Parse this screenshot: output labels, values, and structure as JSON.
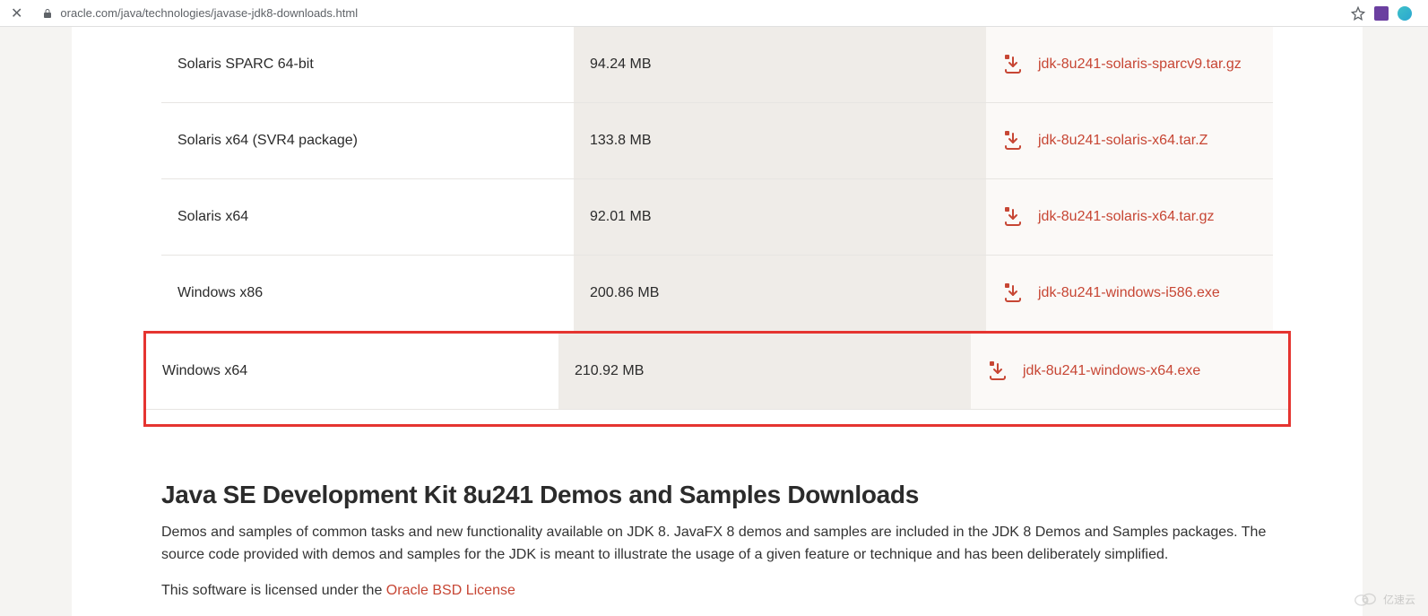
{
  "browser": {
    "url": "oracle.com/java/technologies/javase-jdk8-downloads.html"
  },
  "downloads": [
    {
      "os": "Solaris SPARC 64-bit",
      "size": "94.24 MB",
      "file": "jdk-8u241-solaris-sparcv9.tar.gz",
      "highlighted": false
    },
    {
      "os": "Solaris x64 (SVR4 package)",
      "size": "133.8 MB",
      "file": "jdk-8u241-solaris-x64.tar.Z",
      "highlighted": false
    },
    {
      "os": "Solaris x64",
      "size": "92.01 MB",
      "file": "jdk-8u241-solaris-x64.tar.gz",
      "highlighted": false
    },
    {
      "os": "Windows x86",
      "size": "200.86 MB",
      "file": "jdk-8u241-windows-i586.exe",
      "highlighted": false
    },
    {
      "os": "Windows x64",
      "size": "210.92 MB",
      "file": "jdk-8u241-windows-x64.exe",
      "highlighted": true
    }
  ],
  "section": {
    "heading": "Java SE Development Kit 8u241 Demos and Samples Downloads",
    "desc": "Demos and samples of common tasks and new functionality available on JDK 8. JavaFX 8 demos and samples are included in the JDK 8 Demos and Samples packages. The source code provided with demos and samples for the JDK is meant to illustrate the usage of a given feature or technique and has been deliberately simplified.",
    "license_prefix": "This software is licensed under the ",
    "license_link_text": "Oracle BSD License"
  },
  "watermark": "亿速云"
}
